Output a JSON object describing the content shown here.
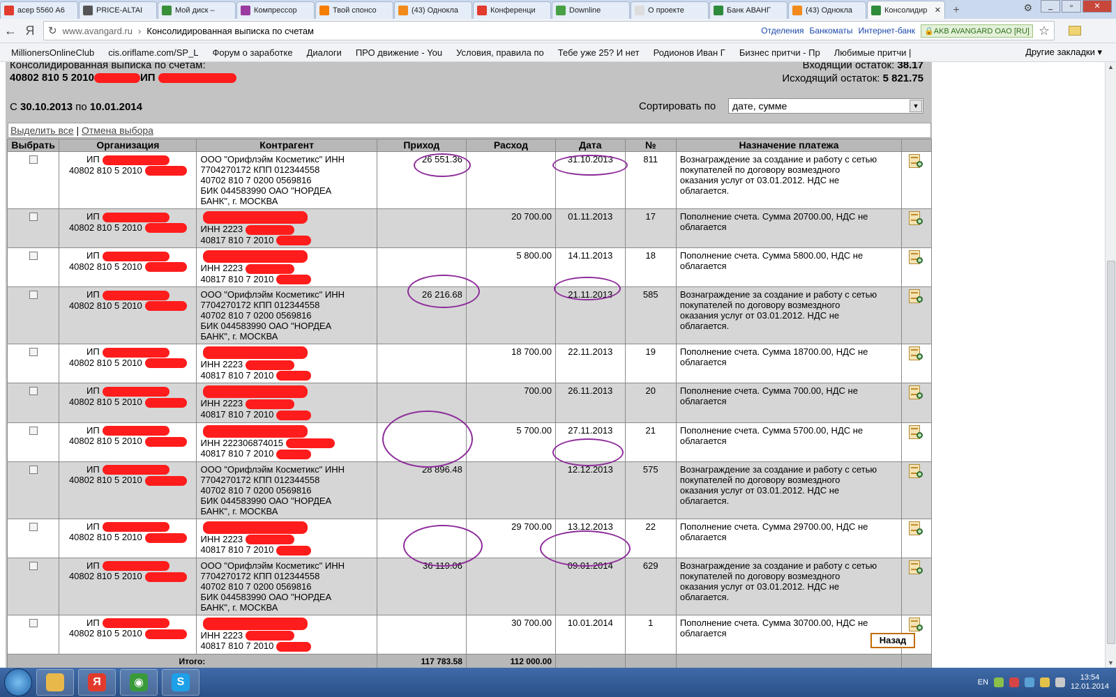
{
  "browser": {
    "tabs": [
      {
        "title": "асер 5560 А6",
        "icon": "yandex-icon",
        "color": "#e23b2e"
      },
      {
        "title": "PRICE-ALTAI",
        "icon": "p-icon",
        "color": "#555555"
      },
      {
        "title": "Мой диск – ",
        "icon": "google-drive-icon",
        "color": "#3a8f3a"
      },
      {
        "title": "Компрессор",
        "icon": "compressor-icon",
        "color": "#9b3aa0"
      },
      {
        "title": "Твой спонсо",
        "icon": "blogger-icon",
        "color": "#f57d00"
      },
      {
        "title": "(43) Однокла",
        "icon": "odnoklassniki-icon",
        "color": "#f28a1c"
      },
      {
        "title": "Конференци",
        "icon": "yandex-icon",
        "color": "#e23b2e"
      },
      {
        "title": "Downline",
        "icon": "downline-icon",
        "color": "#47a043"
      },
      {
        "title": "О проекте",
        "icon": "page-icon",
        "color": "#dddddd"
      },
      {
        "title": "Банк АВАНГ",
        "icon": "bank-icon",
        "color": "#2f8b3c"
      },
      {
        "title": "(43) Однокла",
        "icon": "odnoklassniki-icon",
        "color": "#f28a1c"
      },
      {
        "title": "Консолидир",
        "icon": "bank-icon",
        "color": "#2f8b3c",
        "active": true
      }
    ],
    "url_domain": "www.avangard.ru",
    "url_sep": "›",
    "url_title": "Консолидированная выписка по счетам",
    "url_links": [
      "Отделения",
      "Банкоматы",
      "Интернет-банк"
    ],
    "secure_badge": "AKB AVANGARD OAO [RU]",
    "bookmarks": [
      "MillionersOnlineClub",
      "cis.oriflame.com/SP_L",
      "Форум о заработке",
      "Диалоги",
      "ПРО движение - You",
      "Условия, правила по",
      "Тебе уже 25? И нет",
      "Родионов Иван Г",
      "Бизнес притчи - Пр",
      "Любимые притчи | "
    ],
    "bookmarks_more": "Другие закладки ▾"
  },
  "statement": {
    "title": "Консолидированная выписка по счетам:",
    "account_prefix": "40802 810 5 2010",
    "owner_prefix": "ИП",
    "incoming_label": "Входящий остаток:",
    "incoming_value": "38.17",
    "outgoing_label": "Исходящий остаток:",
    "outgoing_value": "5 821.75",
    "period_from_label": "С",
    "period_from": "30.10.2013",
    "period_to_label": "по",
    "period_to": "10.01.2014",
    "sort_label": "Сортировать по",
    "sort_value": "дате, сумме",
    "select_all": "Выделить все",
    "select_sep": "|",
    "deselect": "Отмена выбора",
    "back_button": "Назад"
  },
  "table": {
    "headers": [
      "Выбрать",
      "Организация",
      "Контрагент",
      "Приход",
      "Расход",
      "Дата",
      "№",
      "Назначение платежа"
    ],
    "rows": [
      {
        "org1": "ИП",
        "org2": "40802 810 5 2010",
        "cp": [
          "ООО \"Орифлэйм Косметикс\" ИНН",
          "7704270172 КПП 012344558",
          "40702 810 7 0200 0569816",
          "БИК 044583990 ОАО \"НОРДЕА",
          "БАНК\", г. МОСКВА"
        ],
        "income": "26 551.36",
        "expense": "",
        "date": "31.10.2013",
        "no": "811",
        "purpose": [
          "Вознаграждение за создание и работу с сетью",
          "покупателей по договору возмездного",
          "оказания услуг от 03.01.2012. НДС не",
          "облагается."
        ]
      },
      {
        "org1": "ИП",
        "org2": "40802 810 5 2010",
        "cp": [
          "",
          "ИНН 2223",
          "40817 810 7 2010"
        ],
        "income": "",
        "expense": "20 700.00",
        "date": "01.11.2013",
        "no": "17",
        "purpose": [
          "Пополнение счета. Сумма 20700.00, НДС не",
          "облагается"
        ]
      },
      {
        "org1": "ИП",
        "org2": "40802 810 5 2010",
        "cp": [
          "",
          "ИНН 2223",
          "40817 810 7 2010"
        ],
        "income": "",
        "expense": "5 800.00",
        "date": "14.11.2013",
        "no": "18",
        "purpose": [
          "Пополнение счета. Сумма 5800.00, НДС не",
          "облагается"
        ]
      },
      {
        "org1": "ИП",
        "org2": "40802 810 5 2010",
        "cp": [
          "ООО \"Орифлэйм Косметикс\" ИНН",
          "7704270172 КПП 012344558",
          "40702 810 7 0200 0569816",
          "БИК 044583990 ОАО \"НОРДЕА",
          "БАНК\", г. МОСКВА"
        ],
        "income": "26 216.68",
        "expense": "",
        "date": "21.11.2013",
        "no": "585",
        "purpose": [
          "Вознаграждение за создание и работу с сетью",
          "покупателей по договору возмездного",
          "оказания услуг от 03.01.2012. НДС не",
          "облагается."
        ]
      },
      {
        "org1": "ИП",
        "org2": "40802 810 5 2010",
        "cp": [
          "",
          "ИНН 2223",
          "40817 810 7 2010"
        ],
        "income": "",
        "expense": "18 700.00",
        "date": "22.11.2013",
        "no": "19",
        "purpose": [
          "Пополнение счета. Сумма 18700.00, НДС не",
          "облагается"
        ]
      },
      {
        "org1": "ИП",
        "org2": "40802 810 5 2010",
        "cp": [
          "",
          "ИНН 2223",
          "40817 810 7 2010"
        ],
        "income": "",
        "expense": "700.00",
        "date": "26.11.2013",
        "no": "20",
        "purpose": [
          "Пополнение счета. Сумма 700.00, НДС не",
          "облагается"
        ]
      },
      {
        "org1": "ИП",
        "org2": "40802 810 5 2010",
        "cp": [
          "",
          "ИНН 222306874015",
          "40817 810 7 2010"
        ],
        "income": "",
        "expense": "5 700.00",
        "date": "27.11.2013",
        "no": "21",
        "purpose": [
          "Пополнение счета. Сумма 5700.00, НДС не",
          "облагается"
        ]
      },
      {
        "org1": "ИП",
        "org2": "40802 810 5 2010",
        "cp": [
          "ООО \"Орифлэйм Косметикс\" ИНН",
          "7704270172 КПП 012344558",
          "40702 810 7 0200 0569816",
          "БИК 044583990 ОАО \"НОРДЕА",
          "БАНК\", г. МОСКВА"
        ],
        "income": "28 896.48",
        "expense": "",
        "date": "12.12.2013",
        "no": "575",
        "purpose": [
          "Вознаграждение за создание и работу с сетью",
          "покупателей по договору возмездного",
          "оказания услуг от 03.01.2012. НДС не",
          "облагается."
        ]
      },
      {
        "org1": "ИП",
        "org2": "40802 810 5 2010",
        "cp": [
          "",
          "ИНН 2223",
          "40817 810 7 2010"
        ],
        "income": "",
        "expense": "29 700.00",
        "date": "13.12.2013",
        "no": "22",
        "purpose": [
          "Пополнение счета. Сумма 29700.00, НДС не",
          "облагается"
        ]
      },
      {
        "org1": "ИП",
        "org2": "40802 810 5 2010",
        "cp": [
          "ООО \"Орифлэйм Косметикс\" ИНН",
          "7704270172 КПП 012344558",
          "40702 810 7 0200 0569816",
          "БИК 044583990 ОАО \"НОРДЕА",
          "БАНК\", г. МОСКВА"
        ],
        "income": "36 119.06",
        "expense": "",
        "date": "09.01.2014",
        "no": "629",
        "purpose": [
          "Вознаграждение за создание и работу с сетью",
          "покупателей по договору возмездного",
          "оказания услуг от 03.01.2012. НДС не",
          "облагается."
        ]
      },
      {
        "org1": "ИП",
        "org2": "40802 810 5 2010",
        "cp": [
          "",
          "ИНН 2223",
          "40817 810 7 2010"
        ],
        "income": "",
        "expense": "30 700.00",
        "date": "10.01.2014",
        "no": "1",
        "purpose": [
          "Пополнение счета. Сумма 30700.00, НДС не",
          "облагается"
        ]
      }
    ],
    "total_label": "Итого:",
    "total_income": "117 783.58",
    "total_expense": "112 000.00"
  },
  "taskbar": {
    "apps": [
      {
        "icon": "explorer-folder-icon",
        "color": "#e8b84a",
        "glyph": ""
      },
      {
        "icon": "yandex-browser-icon",
        "color": "#e23b2e",
        "glyph": "Я"
      },
      {
        "icon": "chrome-icon",
        "color": "#3a9a3a",
        "glyph": "◉"
      },
      {
        "icon": "skype-icon",
        "color": "#1ea0e8",
        "glyph": "S"
      }
    ],
    "lang": "EN",
    "time": "13:54",
    "date": "12.01.2014"
  }
}
